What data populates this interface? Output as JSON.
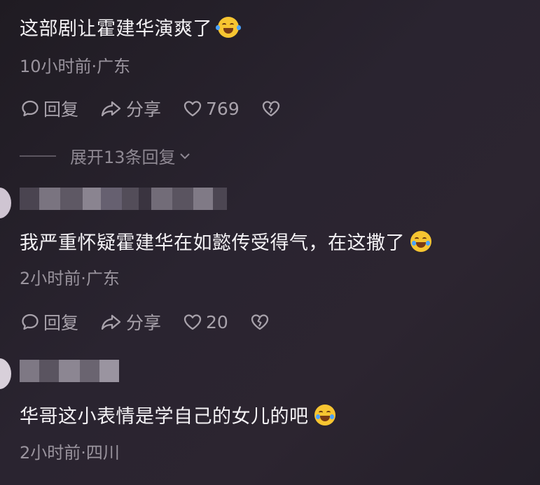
{
  "comments": [
    {
      "text": "这部剧让霍建华演爽了",
      "emoji": "laughing-tears-emoji",
      "meta": "10小时前·广东",
      "reply_label": "回复",
      "share_label": "分享",
      "likes": "769",
      "expand_label": "展开13条回复"
    },
    {
      "text": "我严重怀疑霍建华在如懿传受得气，在这撒了",
      "emoji": "crying-laughing-emoji",
      "meta": "2小时前·广东",
      "reply_label": "回复",
      "share_label": "分享",
      "likes": "20"
    },
    {
      "text": "华哥这小表情是学自己的女儿的吧",
      "emoji": "crying-laughing-emoji",
      "meta": "2小时前·四川"
    }
  ],
  "icons": {
    "reply": "comment-bubble-icon",
    "share": "share-arrow-icon",
    "like": "heart-icon",
    "dislike": "broken-heart-icon",
    "expand": "chevron-down-icon"
  },
  "colors": {
    "background": "#2a2430",
    "primary_text": "#f4f2f5",
    "secondary_text": "#9a949e",
    "emoji_yellow": "#f7c531"
  }
}
